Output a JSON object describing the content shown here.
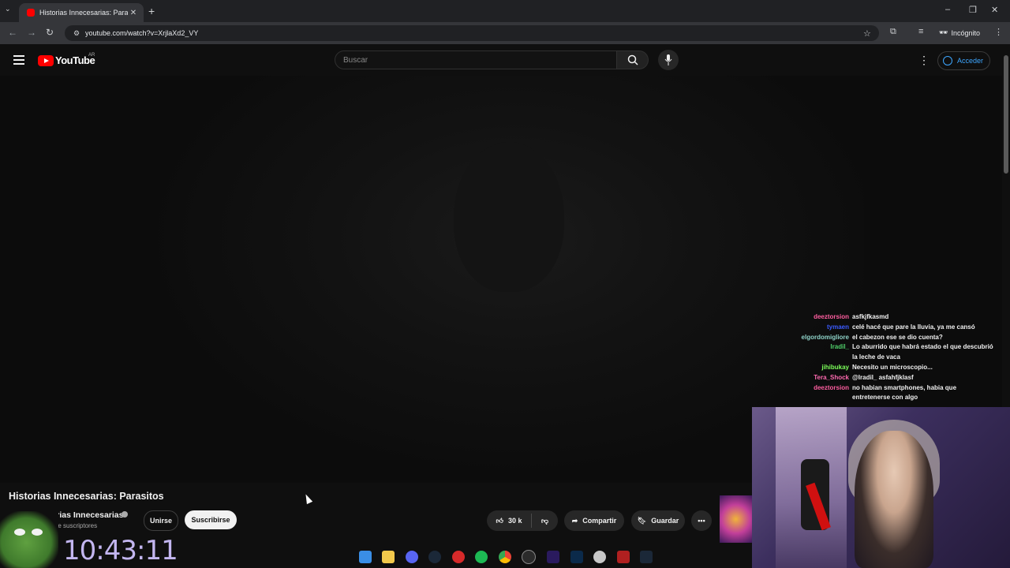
{
  "browser": {
    "tab_title": "Historias Innecesarias: Paras",
    "url": "youtube.com/watch?v=XrjlaXd2_VY",
    "incognito_label": "Incógnito"
  },
  "youtube": {
    "logo_text": "YouTube",
    "country_code": "AR",
    "search_placeholder": "Buscar",
    "signin_label": "Acceder"
  },
  "video": {
    "title": "Historias Innecesarias: Parasitos",
    "channel": "Historias Innecesarias",
    "subscribers": "M de suscriptores",
    "join_label": "Unirse",
    "subscribe_label": "Suscribirse",
    "likes": "30 k",
    "share_label": "Compartir",
    "save_label": "Guardar"
  },
  "chat": [
    {
      "user": "deeztorsion",
      "color": "#ff5ea0",
      "message": "asfkjfkasmd"
    },
    {
      "user": "tymaen",
      "color": "#3b5bff",
      "message": "celé hacé que pare la lluvia, ya me cansó"
    },
    {
      "user": "elgordomigliore",
      "color": "#8fd3c9",
      "message": "el cabezon ese se dio cuenta?"
    },
    {
      "user": "Iradil_",
      "color": "#4fd06a",
      "message": "Lo aburrido que habrá estado el que descubrió la leche de vaca"
    },
    {
      "user": "jihibukay",
      "color": "#7cff5a",
      "message": "Necesito un microscopio..."
    },
    {
      "user": "Tera_Shock",
      "color": "#ff6ab0",
      "message": "@Iradil_ asfahfjklasf"
    },
    {
      "user": "deeztorsion",
      "color": "#ff5ea0",
      "message": "no habian smartphones, habia que entretenerse con algo"
    }
  ],
  "overlay": {
    "clock": "10:43:11"
  },
  "icons": {
    "taskbar": [
      "windows-start-icon",
      "file-explorer-icon",
      "discord-icon",
      "steam-icon",
      "app-red-icon",
      "spotify-icon",
      "chrome-icon",
      "obs-icon",
      "premiere-icon",
      "photoshop-icon",
      "ccleaner-icon",
      "app-banner-icon",
      "steam-tray-icon"
    ]
  },
  "colors": {
    "background": "#0f0f0f",
    "accent_link": "#3ea6ff",
    "youtube_red": "#ff0000",
    "clock_color": "#c3b6f0"
  }
}
